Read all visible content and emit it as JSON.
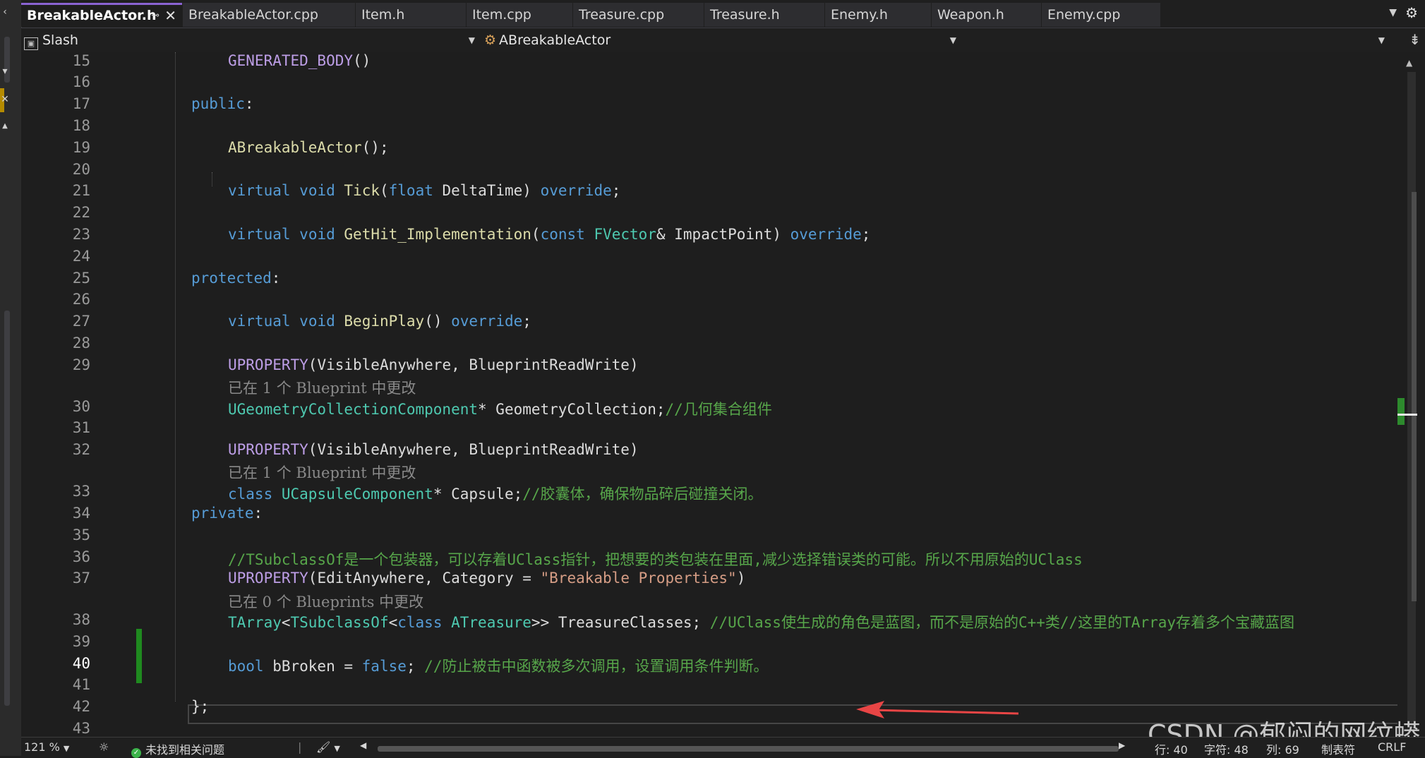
{
  "tabs": [
    {
      "label": "BreakableActor.h",
      "active": true
    },
    {
      "label": "BreakableActor.cpp"
    },
    {
      "label": "Item.h"
    },
    {
      "label": "Item.cpp"
    },
    {
      "label": "Treasure.cpp"
    },
    {
      "label": "Treasure.h"
    },
    {
      "label": "Enemy.h"
    },
    {
      "label": "Weapon.h"
    },
    {
      "label": "Enemy.cpp"
    }
  ],
  "nav": {
    "project": "Slash",
    "scope": "ABreakableActor",
    "member": ""
  },
  "line_numbers": [
    "15",
    "16",
    "17",
    "18",
    "19",
    "20",
    "21",
    "22",
    "23",
    "24",
    "25",
    "26",
    "27",
    "28",
    "29",
    "30",
    "31",
    "32",
    "33",
    "34",
    "35",
    "36",
    "37",
    "38",
    "39",
    "40",
    "41",
    "42",
    "43"
  ],
  "hints": {
    "h1": "已在 1 个 Blueprint 中更改",
    "h2": "已在 1 个 Blueprint 中更改",
    "h3": "已在 0 个 Blueprints 中更改"
  },
  "code": {
    "l15": {
      "macro": "GENERATED_BODY",
      "punct": "()"
    },
    "l17": {
      "kw": "public",
      "punct": ":"
    },
    "l19": {
      "fn": "ABreakableActor",
      "punct": "();"
    },
    "l21": {
      "kw1": "virtual",
      "kw2": "void",
      "fn": "Tick",
      "p1": "(",
      "kw3": "float",
      "param": " DeltaTime",
      "p2": ") ",
      "kw4": "override",
      "p3": ";"
    },
    "l23": {
      "kw1": "virtual",
      "kw2": "void",
      "fn": "GetHit_Implementation",
      "p1": "(",
      "kw3": "const",
      "ty": "FVector",
      "p2": "& ",
      "param": "ImpactPoint",
      "p3": ") ",
      "kw4": "override",
      "p4": ";"
    },
    "l25": {
      "kw": "protected",
      "punct": ":"
    },
    "l27": {
      "kw1": "virtual",
      "kw2": "void",
      "fn": "BeginPlay",
      "p1": "() ",
      "kw3": "override",
      "p2": ";"
    },
    "l29": {
      "macro": "UPROPERTY",
      "rest": "(VisibleAnywhere, BlueprintReadWrite)"
    },
    "l30": {
      "ty": "UGeometryCollectionComponent",
      "rest": "* GeometryCollection;",
      "comment": "//几何集合组件"
    },
    "l32": {
      "macro": "UPROPERTY",
      "rest": "(VisibleAnywhere, BlueprintReadWrite)"
    },
    "l33": {
      "kw": "class",
      "ty": "UCapsuleComponent",
      "rest": "* Capsule;",
      "comment": "//胶囊体，确保物品碎后碰撞关闭。"
    },
    "l34": {
      "kw": "private",
      "punct": ":"
    },
    "l36": {
      "comment": "//TSubclassOf是一个包装器，可以存着UClass指针，把想要的类包装在里面,减少选择错误类的可能。所以不用原始的UClass"
    },
    "l37": {
      "macro": "UPROPERTY",
      "p1": "(EditAnywhere, Category = ",
      "str": "\"Breakable Properties\"",
      "p2": ")"
    },
    "l38": {
      "ty1": "TArray",
      "p1": "<",
      "ty2": "TSubclassOf",
      "p2": "<",
      "kw": "class",
      "ty3": "ATreasure",
      "p3": ">> TreasureClasses; ",
      "comment": "//UClass使生成的角色是蓝图，而不是原始的C++类//这里的TArray存着多个宝藏蓝图"
    },
    "l40": {
      "kw1": "bool",
      "rest": " bBroken = ",
      "kw2": "false",
      "p": "; ",
      "comment": "//防止被击中函数被多次调用，设置调用条件判断。"
    },
    "l42": {
      "punct": "};"
    }
  },
  "watermark": "CSDN @郁闷的网纹蟒",
  "status": {
    "zoom": "121 %",
    "issues": "未找到相关问题",
    "line": "行: 40",
    "char": "字符: 48",
    "col": "列: 69",
    "tabs": "制表符",
    "eol": "CRLF"
  },
  "colors": {
    "keyword": "#569cd6",
    "function": "#dcdcaa",
    "type": "#4ec9b0",
    "comment": "#57a64a",
    "string": "#d69d85",
    "macro": "#bd9ee6",
    "change_marker": "#1f8a1f",
    "annotation_arrow": "#e84545",
    "active_tab_accent": "#8a63d2"
  }
}
